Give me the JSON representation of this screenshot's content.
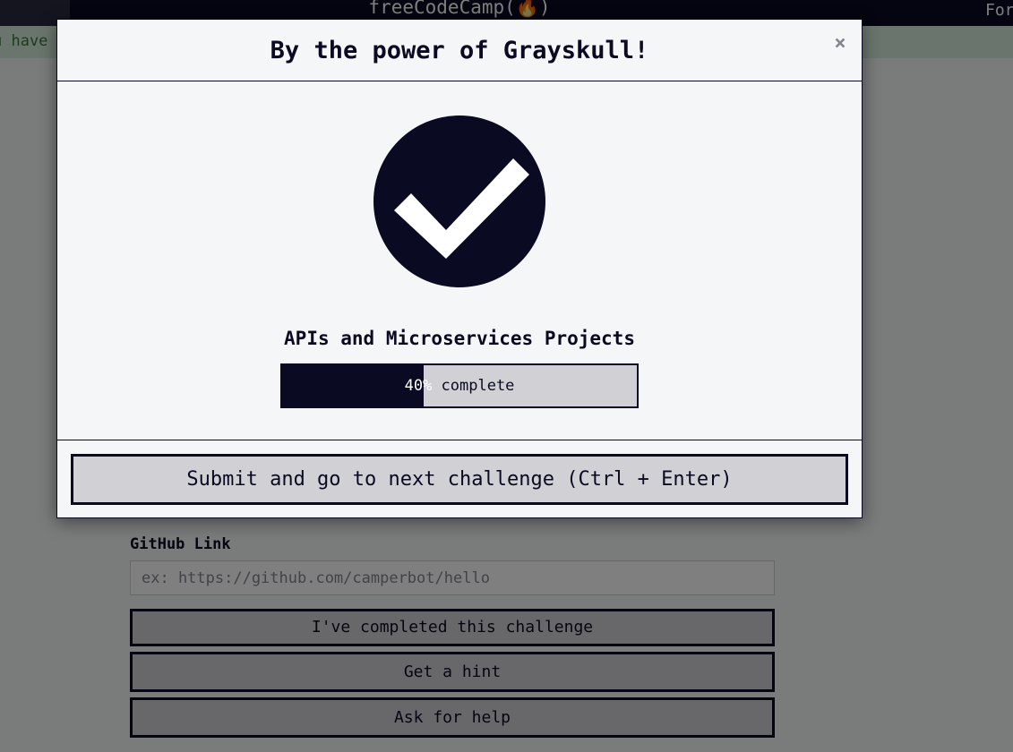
{
  "nav": {
    "brand": "freeCodeCamp(🔥)",
    "right_link": "For"
  },
  "flash": {
    "message": "u have"
  },
  "project_form": {
    "github_label": "GitHub Link",
    "github_placeholder": "ex: https://github.com/camperbot/hello",
    "completed_button": "I've completed this challenge",
    "hint_button": "Get a hint",
    "help_button": "Ask for help"
  },
  "modal": {
    "title": "By the power of Grayskull!",
    "close_symbol": "×",
    "block_name": "APIs and Microservices Projects",
    "progress_percent": 40,
    "progress_percent_label": "40%",
    "progress_suffix": " complete",
    "submit_button": "Submit and go to next challenge (Ctrl + Enter)"
  },
  "colors": {
    "primary_dark": "#0a0a23",
    "button_gray": "#d0d0d5",
    "modal_background": "#f5f6f7",
    "flash_green": "#d4edda"
  },
  "icons": {
    "success": "check-circle-icon",
    "close": "close-icon",
    "brand_flame": "flame-icon"
  }
}
